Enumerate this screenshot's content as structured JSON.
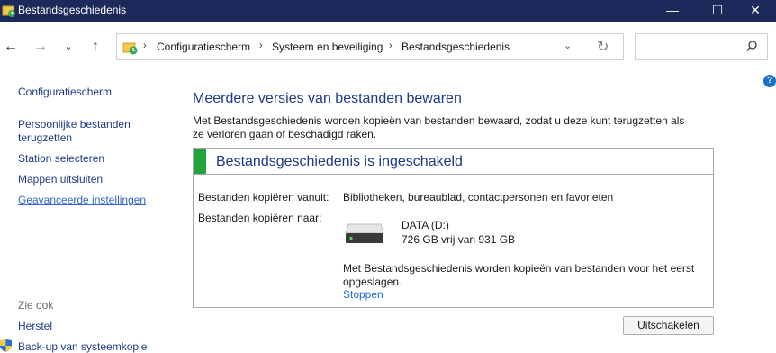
{
  "window": {
    "title": "Bestandsgeschiedenis",
    "minimize_icon": "minimize-icon",
    "maximize_icon": "maximize-icon",
    "close_icon": "close-icon"
  },
  "navigation": {
    "back_icon": "arrow-left-icon",
    "forward_icon": "arrow-right-icon",
    "recent_icon": "chevron-down-icon",
    "up_icon": "arrow-up-icon",
    "breadcrumbs": [
      "Configuratiescherm",
      "Systeem en beveiliging",
      "Bestandsgeschiedenis"
    ],
    "search_placeholder": ""
  },
  "sidebar": {
    "items": [
      {
        "label": "Configuratiescherm"
      },
      {
        "label": "Persoonlijke bestanden"
      },
      {
        "label": "terugzetten"
      },
      {
        "label": "Station selecteren"
      },
      {
        "label": "Mappen uitsluiten"
      },
      {
        "label": "Geavanceerde instellingen"
      }
    ],
    "see_also": "Zie ook",
    "see_also_items": [
      {
        "label": "Herstel"
      },
      {
        "label": "Back-up van systeemkopie"
      }
    ]
  },
  "main": {
    "title": "Meerdere versies van bestanden bewaren",
    "description": "Met Bestandsgeschiedenis worden kopieën van bestanden bewaard, zodat u deze kunt terugzetten als ze verloren gaan of beschadigd raken.",
    "status": {
      "title": "Bestandsgeschiedenis is ingeschakeld",
      "color": "#23a23d"
    },
    "copy_from_label": "Bestanden kopiëren vanuit:",
    "copy_from_value": "Bibliotheken, bureaublad, contactpersonen en favorieten",
    "copy_to_label": "Bestanden kopiëren naar:",
    "drive_name": "DATA (D:)",
    "drive_space": "726 GB vrij van 931 GB",
    "note": "Met Bestandsgeschiedenis worden kopieën van bestanden voor het eerst opgeslagen.",
    "stop_link": "Stoppen",
    "off_button": "Uitschakelen"
  },
  "help_label": "?"
}
